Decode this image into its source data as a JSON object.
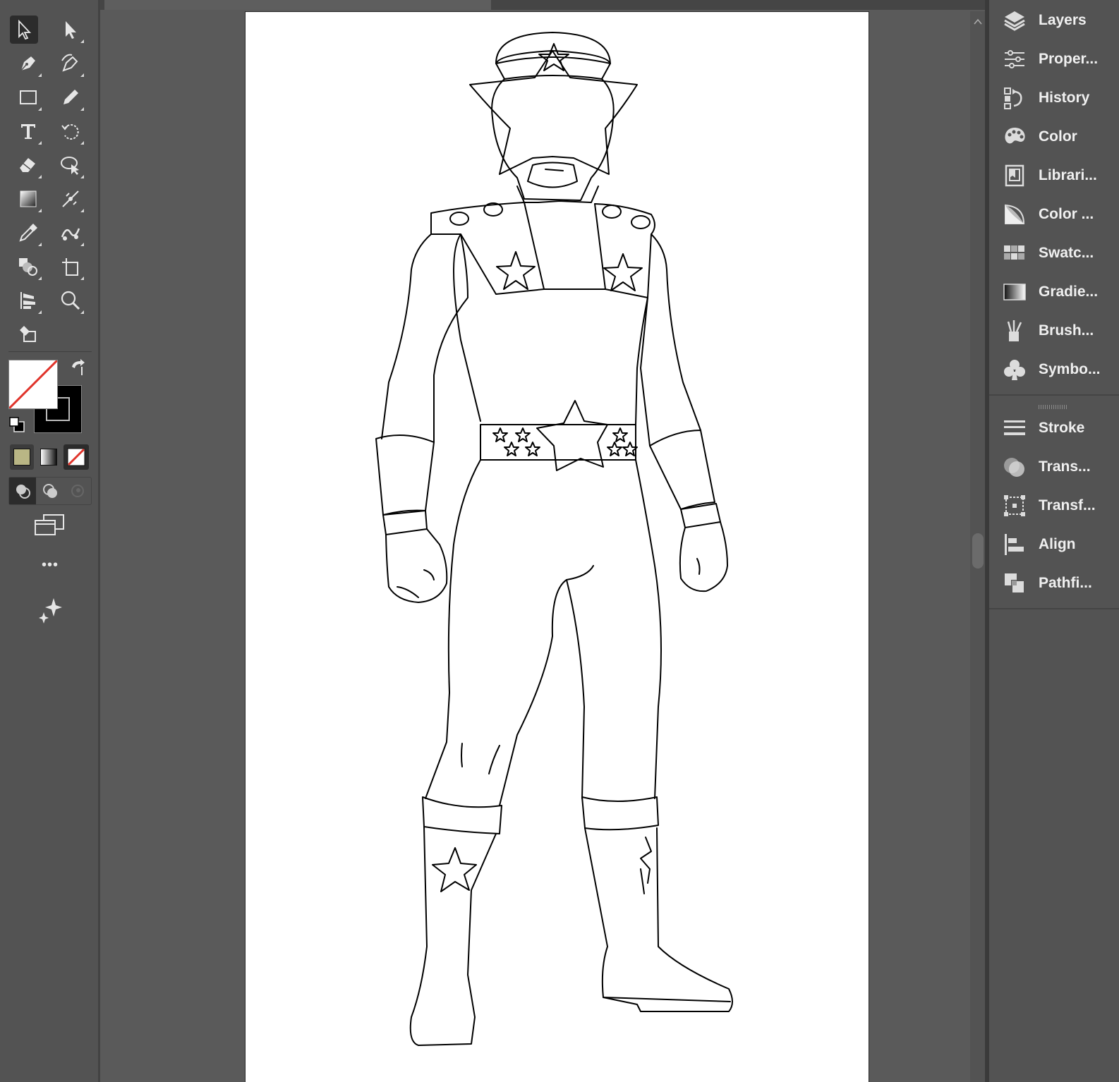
{
  "toolbar": {
    "tools": [
      {
        "name": "selection-tool",
        "icon": "arrow-outline-icon",
        "active": true
      },
      {
        "name": "direct-selection-tool",
        "icon": "arrow-solid-icon"
      },
      {
        "name": "pen-tool",
        "icon": "pen-icon"
      },
      {
        "name": "curvature-tool",
        "icon": "curvature-pen-icon"
      },
      {
        "name": "rectangle-tool",
        "icon": "rectangle-icon"
      },
      {
        "name": "pencil-tool",
        "icon": "pencil-icon"
      },
      {
        "name": "type-tool",
        "icon": "type-icon"
      },
      {
        "name": "rotate-tool",
        "icon": "rotate-icon"
      },
      {
        "name": "eraser-tool",
        "icon": "eraser-icon"
      },
      {
        "name": "puppet-warp-tool",
        "icon": "puppet-warp-icon"
      },
      {
        "name": "gradient-tool",
        "icon": "gradient-icon"
      },
      {
        "name": "width-tool",
        "icon": "width-icon"
      },
      {
        "name": "eyedropper-tool",
        "icon": "eyedropper-icon"
      },
      {
        "name": "blend-tool",
        "icon": "blend-icon"
      },
      {
        "name": "shape-builder-tool",
        "icon": "shape-builder-icon"
      },
      {
        "name": "artboard-tool",
        "icon": "artboard-icon"
      },
      {
        "name": "column-graph-tool",
        "icon": "column-graph-icon"
      },
      {
        "name": "zoom-tool",
        "icon": "zoom-icon"
      },
      {
        "name": "live-paint-tool",
        "icon": "live-paint-icon"
      }
    ],
    "fill_stroke": {
      "fill": "none",
      "stroke": "#000000"
    },
    "color_modes": [
      "color",
      "gradient",
      "none"
    ],
    "draw_modes": [
      "draw-normal",
      "draw-behind",
      "draw-inside"
    ],
    "more_label": "•••",
    "colors": {
      "fill_swatch": "#b9b685",
      "none_red": "#e0342b"
    }
  },
  "panels": {
    "group1": [
      {
        "label": "Layers",
        "icon": "layers-icon"
      },
      {
        "label": "Proper...",
        "icon": "properties-icon"
      },
      {
        "label": "History",
        "icon": "history-icon"
      },
      {
        "label": "Color",
        "icon": "color-palette-icon"
      },
      {
        "label": "Librari...",
        "icon": "libraries-icon"
      },
      {
        "label": "Color ...",
        "icon": "color-guide-icon"
      },
      {
        "label": "Swatc...",
        "icon": "swatches-icon"
      },
      {
        "label": "Gradie...",
        "icon": "gradient-panel-icon"
      },
      {
        "label": "Brush...",
        "icon": "brushes-icon"
      },
      {
        "label": "Symbo...",
        "icon": "symbols-icon"
      }
    ],
    "group2": [
      {
        "label": "Stroke",
        "icon": "stroke-icon"
      },
      {
        "label": "Trans...",
        "icon": "transparency-icon"
      },
      {
        "label": "Transf...",
        "icon": "transform-icon"
      },
      {
        "label": "Align",
        "icon": "align-icon"
      },
      {
        "label": "Pathfi...",
        "icon": "pathfinder-icon"
      }
    ]
  },
  "artboard": {
    "subject": "line-art-ranger-figure"
  }
}
